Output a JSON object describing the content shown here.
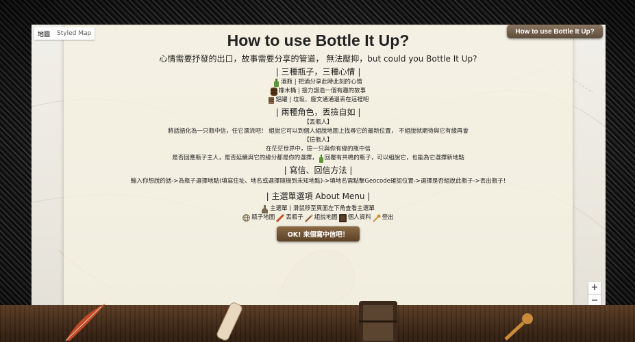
{
  "map_type": {
    "options": [
      "地圖",
      "Styled Map"
    ],
    "selected": "地圖"
  },
  "header_button": "How to use Bottle It Up?",
  "title": "How to use Bottle It Up?",
  "subtitle": "心情需要抒發的出口，故事需要分享的管道， 無法壓抑，but could you Bottle It Up?",
  "sections": {
    "bottles": {
      "heading": "| 三種瓶子，三種心情 |",
      "items": [
        {
          "icon": "green-bottle-icon",
          "text": "酒瓶 | 把酒分享此時此刻的心情"
        },
        {
          "icon": "wooden-barrel-icon",
          "text": "橡木桶 | 接力譜造一個有趣的故事"
        },
        {
          "icon": "paper-bundle-icon",
          "text": "鋁罐 | 垃圾、廢文通通還丟在這裡吧"
        }
      ]
    },
    "roles": {
      "heading": "| 兩種角色，丟撿自如 |",
      "thrower_title": "【丟瓶人】",
      "thrower_text": "將話語化為一只瓶中信，任它漂流吧！ 組說它可以到個人組說地圖上找尋它的最新位置， 不組說就期待與它有緣再會",
      "picker_title": "【撿瓶人】",
      "picker_text1": "在茫茫世界中，撿一只與你有緣的瓶中信",
      "picker_text2a": "是否回應瓶子主人，是否延續與它的緣分都是你的選擇，",
      "picker_text2b": "回覆有共鳴的瓶子，可以組說它，也能為它選擇新地點"
    },
    "writing": {
      "heading": "| 寫信、回信方法 |",
      "text": "輸入你想說的話->為瓶子選擇地點(填寫住址、地名或選擇隨機到未知地點)->填地名需點擊Geocode確認位置->選擇是否組說此瓶子->丟出瓶子!"
    },
    "menu": {
      "heading": "| 主選單選項 About Menu |",
      "main_text": "主選單 | 滑鼠移至頁面左下角查看主選單",
      "items": [
        {
          "icon": "globe-icon",
          "label": "瓶子地圖"
        },
        {
          "icon": "feather-icon",
          "label": "丟瓶子"
        },
        {
          "icon": "quill-icon",
          "label": "組說地圖"
        },
        {
          "icon": "book-icon",
          "label": "個人資料"
        },
        {
          "icon": "key-icon",
          "label": "登出"
        }
      ]
    }
  },
  "ok_button": "OK! 來個寫中信吧！",
  "zoom": {
    "in": "+",
    "out": "−"
  },
  "colors": {
    "button_brown": "#5c4127",
    "parchment": "#f5f1e2",
    "frame": "#111111"
  }
}
